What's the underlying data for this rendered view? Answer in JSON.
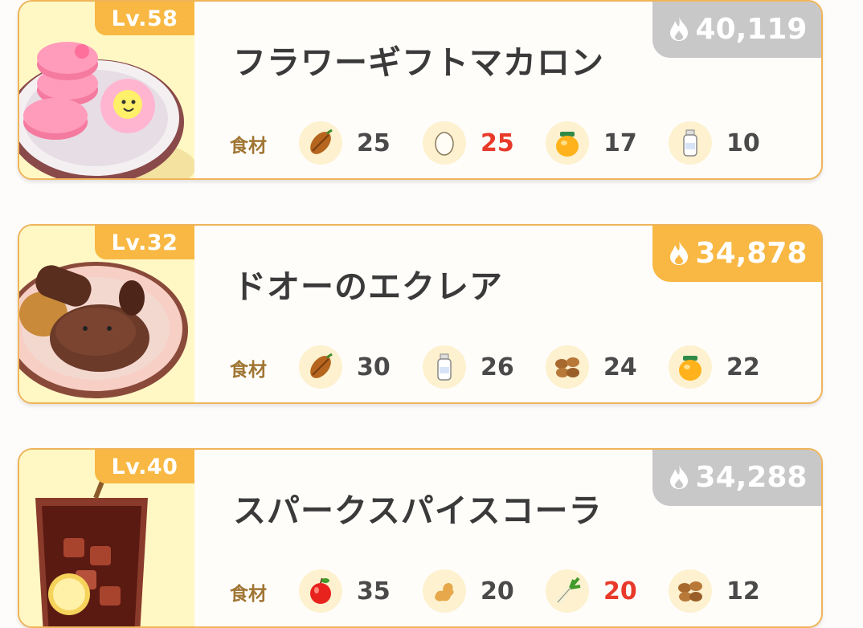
{
  "cards": [
    {
      "level": "Lv.58",
      "name": "フラワーギフトマカロン",
      "power": "40,119",
      "power_style": "gray",
      "ingredients_label": "食材",
      "ingredients": [
        {
          "icon": "cacao-icon",
          "qty": "25",
          "short": false
        },
        {
          "icon": "egg-icon",
          "qty": "25",
          "short": true
        },
        {
          "icon": "honey-jar-icon",
          "qty": "17",
          "short": false
        },
        {
          "icon": "milk-bottle-icon",
          "qty": "10",
          "short": false
        }
      ]
    },
    {
      "level": "Lv.32",
      "name": "ドオーのエクレア",
      "power": "34,878",
      "power_style": "orange",
      "ingredients_label": "食材",
      "ingredients": [
        {
          "icon": "cacao-icon",
          "qty": "30",
          "short": false
        },
        {
          "icon": "milk-bottle-icon",
          "qty": "26",
          "short": false
        },
        {
          "icon": "nuts-icon",
          "qty": "24",
          "short": false
        },
        {
          "icon": "honey-jar-icon",
          "qty": "22",
          "short": false
        }
      ]
    },
    {
      "level": "Lv.40",
      "name": "スパークスパイスコーラ",
      "power": "34,288",
      "power_style": "gray",
      "ingredients_label": "食材",
      "ingredients": [
        {
          "icon": "apple-icon",
          "qty": "35",
          "short": false
        },
        {
          "icon": "ginger-icon",
          "qty": "20",
          "short": false
        },
        {
          "icon": "leek-icon",
          "qty": "20",
          "short": true
        },
        {
          "icon": "nuts-icon",
          "qty": "12",
          "short": false
        }
      ]
    }
  ],
  "colors": {
    "badge": "#f8b843",
    "shortage": "#e83a2a",
    "card_border": "#f0b45a",
    "label": "#a07634"
  }
}
